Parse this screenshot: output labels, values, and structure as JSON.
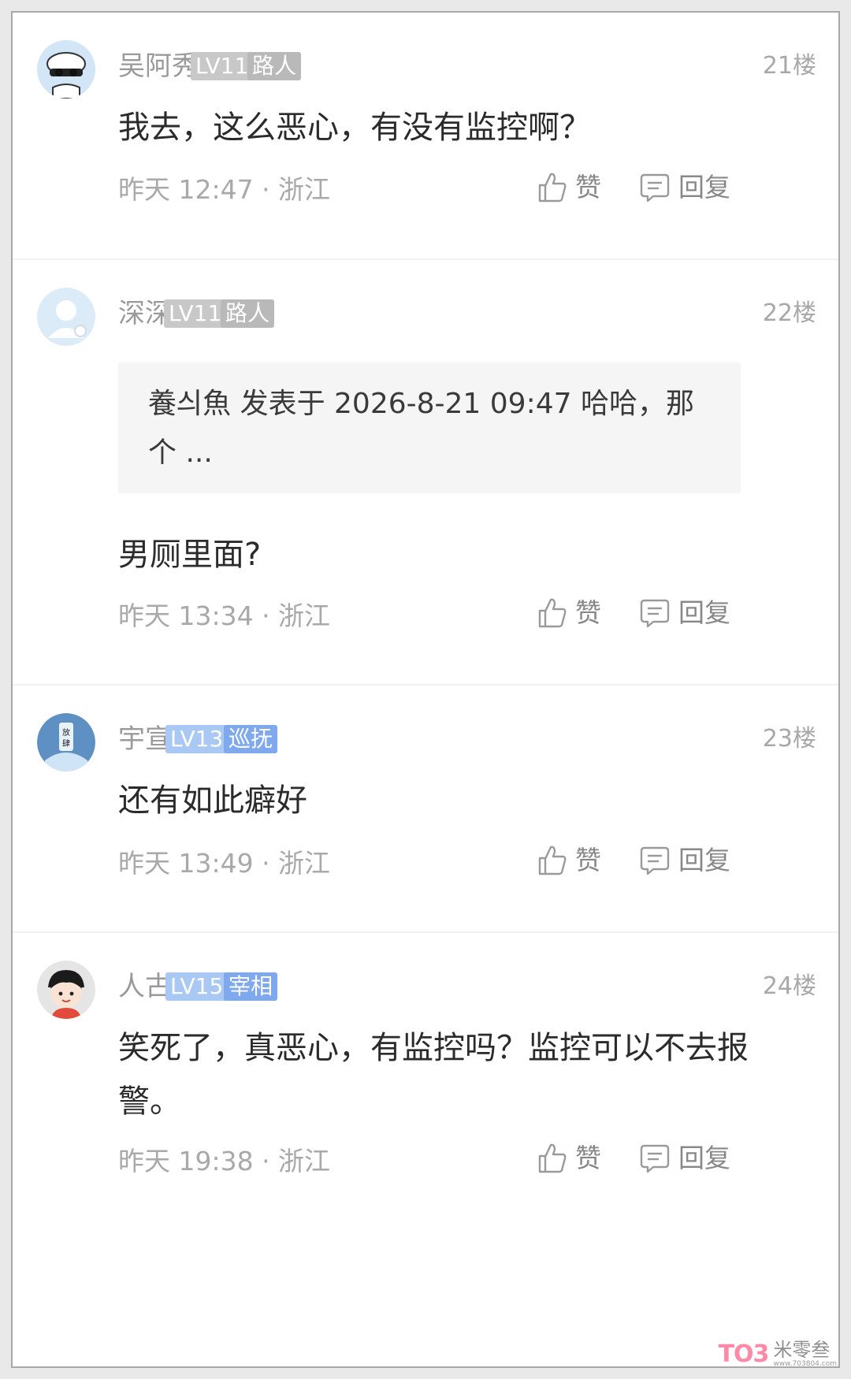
{
  "comments": [
    {
      "username": "吴阿秀",
      "level": "LV11",
      "rank": "路人",
      "floor": "21楼",
      "content": "我去，这么恶心，有没有监控啊？",
      "meta": "昨天 12:47 · 浙江",
      "like_label": "赞",
      "reply_label": "回复"
    },
    {
      "username": "深深",
      "level": "LV11",
      "rank": "路人",
      "floor": "22楼",
      "quote": "養싀魚 发表于 2026-8-21 09:47 哈哈，那个 ...",
      "content": "男厕里面?",
      "meta": "昨天 13:34 · 浙江",
      "like_label": "赞",
      "reply_label": "回复"
    },
    {
      "username": "宇宣",
      "level": "LV13",
      "rank": "巡抚",
      "floor": "23楼",
      "content": "还有如此癖好",
      "meta": "昨天 13:49 · 浙江",
      "like_label": "赞",
      "reply_label": "回复"
    },
    {
      "username": "人古",
      "level": "LV15",
      "rank": "宰相",
      "floor": "24楼",
      "content": "笑死了，真恶心，有监控吗？监控可以不去报警。",
      "meta": "昨天 19:38 · 浙江",
      "like_label": "赞",
      "reply_label": "回复"
    }
  ],
  "colors": {
    "badge_gray": "#c6c6c6",
    "badge_blue_level": "#a9c8f4",
    "badge_blue_rank": "#7fa9ec"
  },
  "watermark": {
    "logo": "TO3",
    "text": "米零叁",
    "url": "www.703804.com"
  }
}
